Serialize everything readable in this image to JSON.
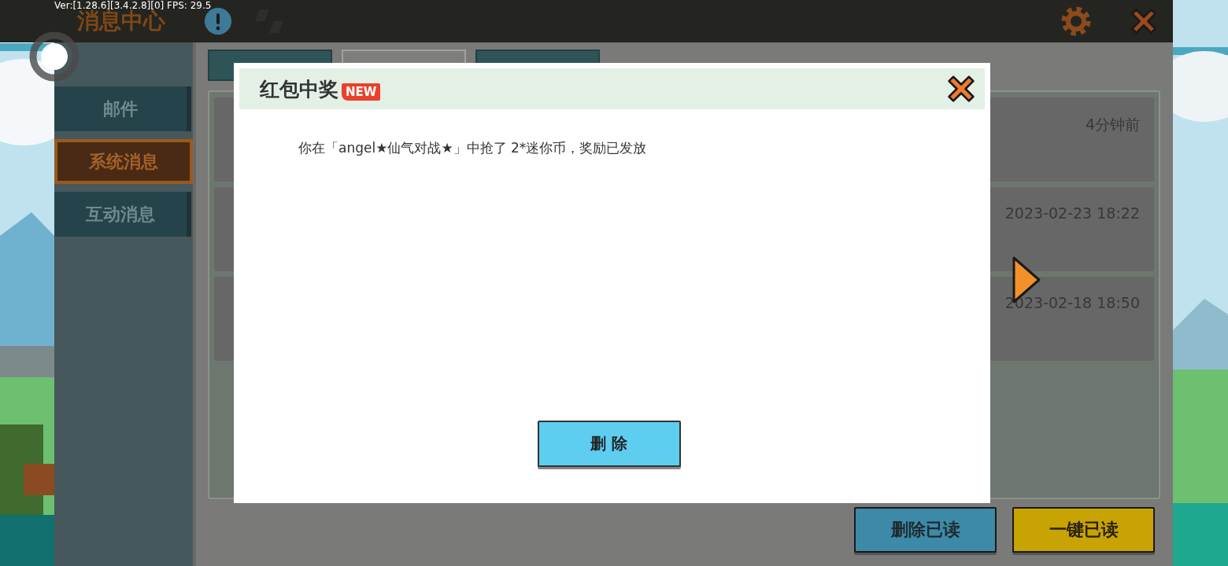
{
  "debug_overlay": "Ver:[1.28.6][3.4.2.8][0] FPS: 29.5",
  "header": {
    "title": "消息中心"
  },
  "sidebar": {
    "items": [
      {
        "label": "邮件",
        "selected": false
      },
      {
        "label": "系统消息",
        "selected": true
      },
      {
        "label": "互动消息",
        "selected": false
      }
    ]
  },
  "tabs": [
    {
      "selected": false
    },
    {
      "selected": true
    },
    {
      "selected": false
    }
  ],
  "messages": [
    {
      "time": "4分钟前"
    },
    {
      "time": "2023-02-23 18:22"
    },
    {
      "time": "2023-02-18 18:50"
    }
  ],
  "footer_buttons": [
    {
      "label": "删除已读",
      "kind": "secondary"
    },
    {
      "label": "一键已读",
      "kind": "primary"
    }
  ],
  "dialog": {
    "title": "红包中奖",
    "badge": "NEW",
    "message": "你在「angel★仙气对战★」中抢了 2*迷你币，奖励已发放",
    "button": "删 除"
  }
}
